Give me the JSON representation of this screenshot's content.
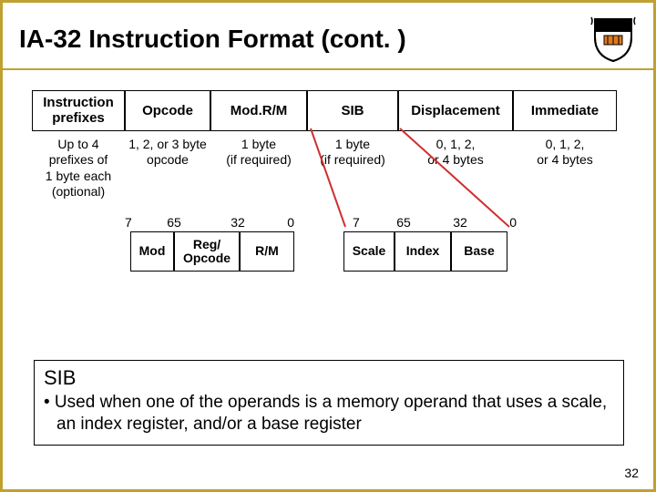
{
  "title": "IA-32 Instruction Format (cont. )",
  "format": {
    "prefix": {
      "header": "Instruction\nprefixes",
      "desc": "Up to 4\nprefixes of\n1 byte each\n(optional)"
    },
    "opcode": {
      "header": "Opcode",
      "desc": "1, 2, or 3 byte\nopcode"
    },
    "modrm": {
      "header": "Mod.R/M",
      "desc": "1 byte\n(if required)"
    },
    "sib": {
      "header": "SIB",
      "desc": "1 byte\n(if required)"
    },
    "disp": {
      "header": "Displacement",
      "desc": "0, 1, 2,\nor 4 bytes"
    },
    "imm": {
      "header": "Immediate",
      "desc": "0, 1, 2,\nor 4 bytes"
    }
  },
  "bits": {
    "modrm": [
      "7",
      "6",
      "5",
      "3",
      "2",
      "0"
    ],
    "sib": [
      "7",
      "6",
      "5",
      "3",
      "2",
      "0"
    ]
  },
  "modrm_fields": {
    "mod": "Mod",
    "reg": "Reg/\nOpcode",
    "rm": "R/M"
  },
  "sib_fields": {
    "scale": "Scale",
    "index": "Index",
    "base": "Base"
  },
  "sib_explain": {
    "label": "SIB",
    "bullet": "• Used when one of the operands is a memory operand that uses a scale, an index register, and/or a base register"
  },
  "pagenum": "32"
}
